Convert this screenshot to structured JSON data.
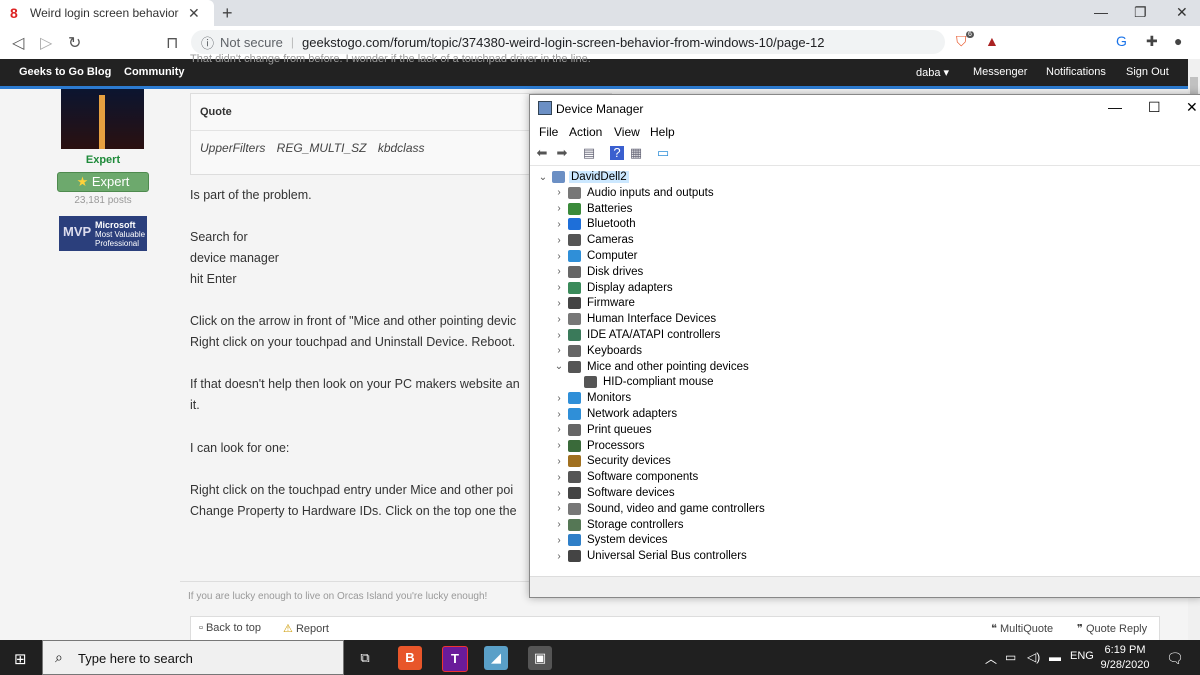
{
  "browser": {
    "tab_title": "Weird login screen behavior from W",
    "security_label": "Not secure",
    "url": "geekstogo.com/forum/topic/374380-weird-login-screen-behavior-from-windows-10/page-12",
    "brave_badge_count": "6"
  },
  "site_nav": {
    "left_items": [
      "Geeks to Go Blog",
      "Community"
    ],
    "user": "daba",
    "right_items": [
      "Messenger",
      "Notifications",
      "Sign Out"
    ],
    "partial_text": "That didn't change from before.  I wonder if the lack of a touchpad driver in the line."
  },
  "profile": {
    "rank": "Expert",
    "badge": "Expert",
    "posts": "23,181 posts",
    "mvp_title": "MVP",
    "mvp_lines": [
      "Microsoft",
      "Most Valuable",
      "Professional"
    ]
  },
  "quote": {
    "header": "Quote",
    "body": "UpperFilters REG_MULTI_SZ kbdclass"
  },
  "post_lines": [
    "Is part of the problem.",
    "Search for",
    "device manager",
    "hit Enter",
    "Click on the arrow in front of \"Mice and other pointing devic",
    "Right click on your touchpad and Uninstall Device.  Reboot.",
    "If that doesn't help then look on your PC makers website an",
    "it.",
    "I can look for one:",
    "Right click on the touchpad entry under Mice and other poi",
    "Change Property to Hardware IDs.  Click on the top one the"
  ],
  "signature": "If you are lucky enough to live on Orcas Island you're lucky enough!",
  "post_actions": {
    "back_to_top": "Back to top",
    "report": "Report",
    "multiquote": "MultiQuote",
    "quote_reply": "Quote Reply"
  },
  "device_manager": {
    "title": "Device Manager",
    "menu": [
      "File",
      "Action",
      "View",
      "Help"
    ],
    "root": "DavidDell2",
    "categories": [
      {
        "label": "Audio inputs and outputs",
        "icon": "speaker-icon",
        "color": "#777777"
      },
      {
        "label": "Batteries",
        "icon": "battery-icon",
        "color": "#3a8a3a"
      },
      {
        "label": "Bluetooth",
        "icon": "bluetooth-icon",
        "color": "#1e6fd9"
      },
      {
        "label": "Cameras",
        "icon": "camera-icon",
        "color": "#555555"
      },
      {
        "label": "Computer",
        "icon": "monitor-icon",
        "color": "#2f8fd8"
      },
      {
        "label": "Disk drives",
        "icon": "disk-icon",
        "color": "#666666"
      },
      {
        "label": "Display adapters",
        "icon": "display-adapter-icon",
        "color": "#3a8a5a"
      },
      {
        "label": "Firmware",
        "icon": "chip-icon",
        "color": "#444444"
      },
      {
        "label": "Human Interface Devices",
        "icon": "keyboard-icon",
        "color": "#777777"
      },
      {
        "label": "IDE ATA/ATAPI controllers",
        "icon": "controller-icon",
        "color": "#3a7a5a"
      },
      {
        "label": "Keyboards",
        "icon": "keyboard-icon",
        "color": "#666666"
      },
      {
        "label": "Mice and other pointing devices",
        "icon": "mouse-icon",
        "color": "#555555",
        "expanded": true
      },
      {
        "label": "Monitors",
        "icon": "monitor-icon",
        "color": "#2f8fd8"
      },
      {
        "label": "Network adapters",
        "icon": "network-icon",
        "color": "#2f8fd8"
      },
      {
        "label": "Print queues",
        "icon": "printer-icon",
        "color": "#666666"
      },
      {
        "label": "Processors",
        "icon": "processor-icon",
        "color": "#3a6a3a"
      },
      {
        "label": "Security devices",
        "icon": "security-icon",
        "color": "#a07020"
      },
      {
        "label": "Software components",
        "icon": "software-icon",
        "color": "#555555"
      },
      {
        "label": "Software devices",
        "icon": "software-icon",
        "color": "#444444"
      },
      {
        "label": "Sound, video and game controllers",
        "icon": "speaker-icon",
        "color": "#777777"
      },
      {
        "label": "Storage controllers",
        "icon": "storage-icon",
        "color": "#557755"
      },
      {
        "label": "System devices",
        "icon": "system-icon",
        "color": "#2f7fc8"
      },
      {
        "label": "Universal Serial Bus controllers",
        "icon": "usb-icon",
        "color": "#444444"
      }
    ],
    "mice_child": "HID-compliant mouse"
  },
  "taskbar": {
    "search_placeholder": "Type here to search",
    "language": "ENG",
    "time": "6:19 PM",
    "date": "9/28/2020"
  }
}
